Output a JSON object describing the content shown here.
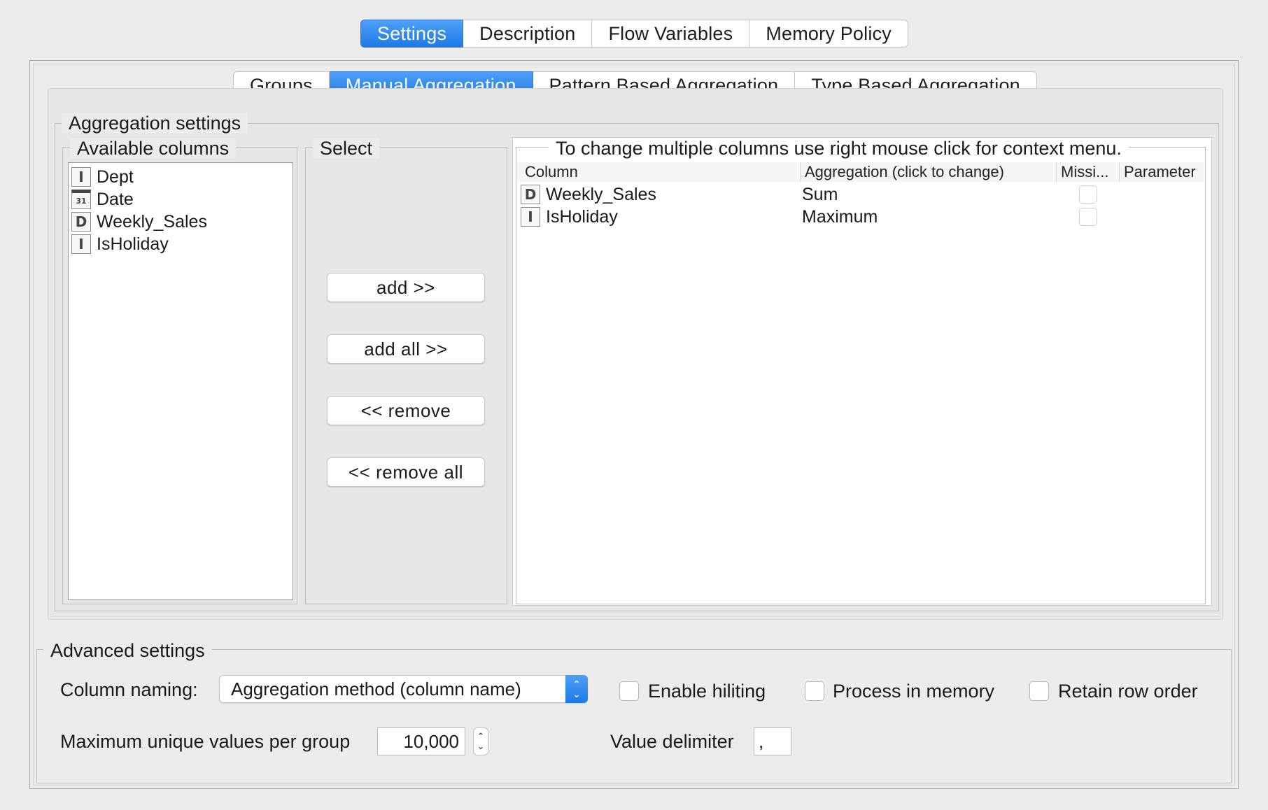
{
  "top_tabs": [
    {
      "label": "Settings",
      "active": true
    },
    {
      "label": "Description",
      "active": false
    },
    {
      "label": "Flow Variables",
      "active": false
    },
    {
      "label": "Memory Policy",
      "active": false
    }
  ],
  "sub_tabs": [
    {
      "label": "Groups",
      "active": false
    },
    {
      "label": "Manual Aggregation",
      "active": true
    },
    {
      "label": "Pattern Based Aggregation",
      "active": false
    },
    {
      "label": "Type Based Aggregation",
      "active": false
    }
  ],
  "aggregation_settings": {
    "title": "Aggregation settings",
    "available_columns": {
      "title": "Available columns",
      "items": [
        {
          "type_icon": "I",
          "type": "integer",
          "label": "Dept"
        },
        {
          "type_icon": "31",
          "type": "date",
          "label": "Date"
        },
        {
          "type_icon": "D",
          "type": "double",
          "label": "Weekly_Sales"
        },
        {
          "type_icon": "I",
          "type": "integer",
          "label": "IsHoliday"
        }
      ]
    },
    "select": {
      "title": "Select",
      "add_label": "add >>",
      "add_all_label": "add all >>",
      "remove_label": "<< remove",
      "remove_all_label": "<< remove all"
    },
    "aggregation_table": {
      "title": "To change multiple columns use right mouse click for context menu.",
      "headers": [
        "Column",
        "Aggregation (click to change)",
        "Missi...",
        "Parameter"
      ],
      "rows": [
        {
          "type_icon": "D",
          "column": "Weekly_Sales",
          "aggregation": "Sum",
          "missing": false,
          "parameter": ""
        },
        {
          "type_icon": "I",
          "column": "IsHoliday",
          "aggregation": "Maximum",
          "missing": false,
          "parameter": ""
        }
      ]
    }
  },
  "advanced_settings": {
    "title": "Advanced settings",
    "column_naming_label": "Column naming:",
    "column_naming_value": "Aggregation method (column name)",
    "enable_hiliting_label": "Enable hiliting",
    "enable_hiliting": false,
    "process_in_memory_label": "Process in memory",
    "process_in_memory": false,
    "retain_row_order_label": "Retain row order",
    "retain_row_order": false,
    "max_unique_label": "Maximum unique values per group",
    "max_unique_value": "10,000",
    "value_delimiter_label": "Value delimiter",
    "value_delimiter_value": ","
  },
  "colors": {
    "accent": "#1c79e6",
    "background": "#ececec"
  }
}
